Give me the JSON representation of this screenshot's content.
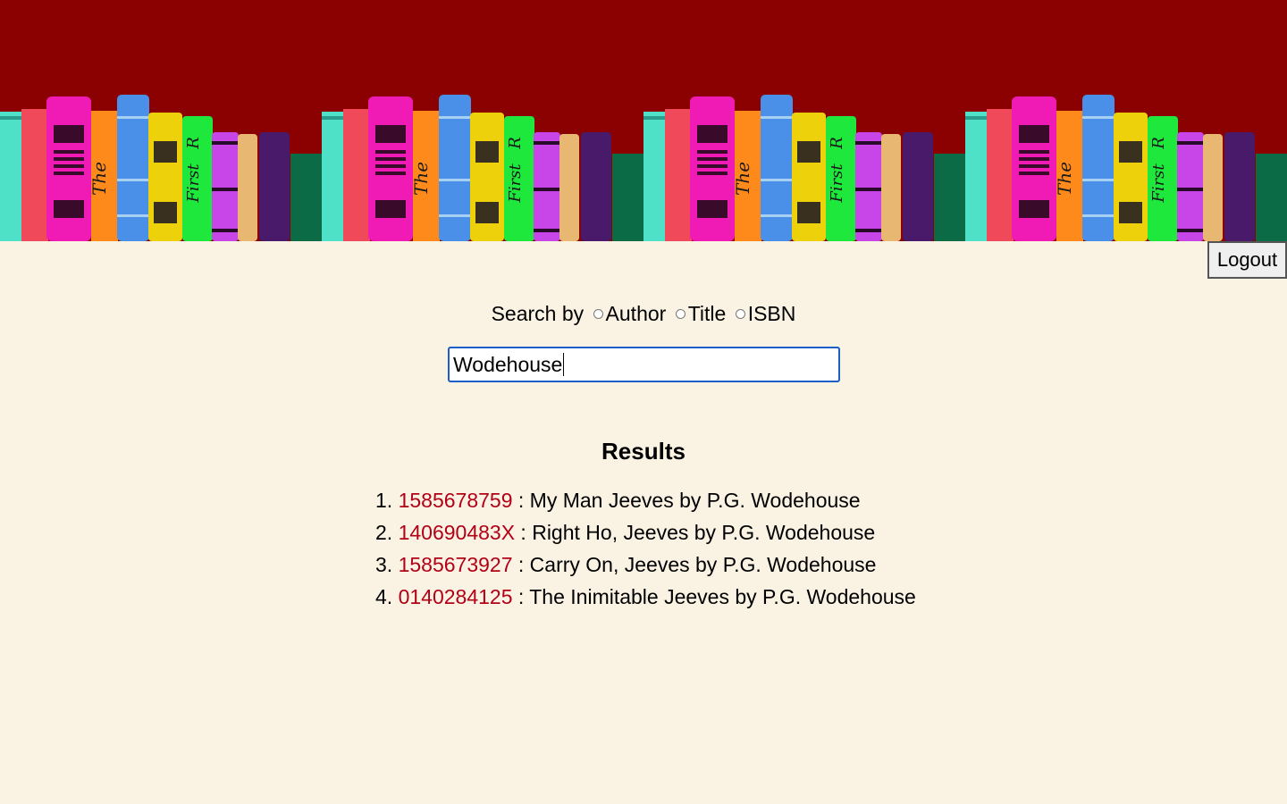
{
  "header": {
    "banner_alt": "Bookshelf banner",
    "banner_spine_text": [
      "The",
      "First",
      "R"
    ]
  },
  "auth": {
    "logout_label": "Logout"
  },
  "search": {
    "prefix": "Search by",
    "options": [
      "Author",
      "Title",
      "ISBN"
    ],
    "value": "Wodehouse"
  },
  "results": {
    "title": "Results",
    "items": [
      {
        "num": "1.",
        "isbn": "1585678759",
        "text": " : My Man Jeeves by P.G. Wodehouse"
      },
      {
        "num": "2.",
        "isbn": "140690483X",
        "text": " : Right Ho, Jeeves by P.G. Wodehouse"
      },
      {
        "num": "3.",
        "isbn": "1585673927",
        "text": " : Carry On, Jeeves by P.G. Wodehouse"
      },
      {
        "num": "4.",
        "isbn": "0140284125",
        "text": " : The Inimitable Jeeves by P.G. Wodehouse"
      }
    ]
  },
  "colors": {
    "banner_bg": "#8b0000",
    "page_bg": "#faf3e4",
    "isbn_link": "#b20016",
    "input_focus": "#1a5fc8"
  }
}
